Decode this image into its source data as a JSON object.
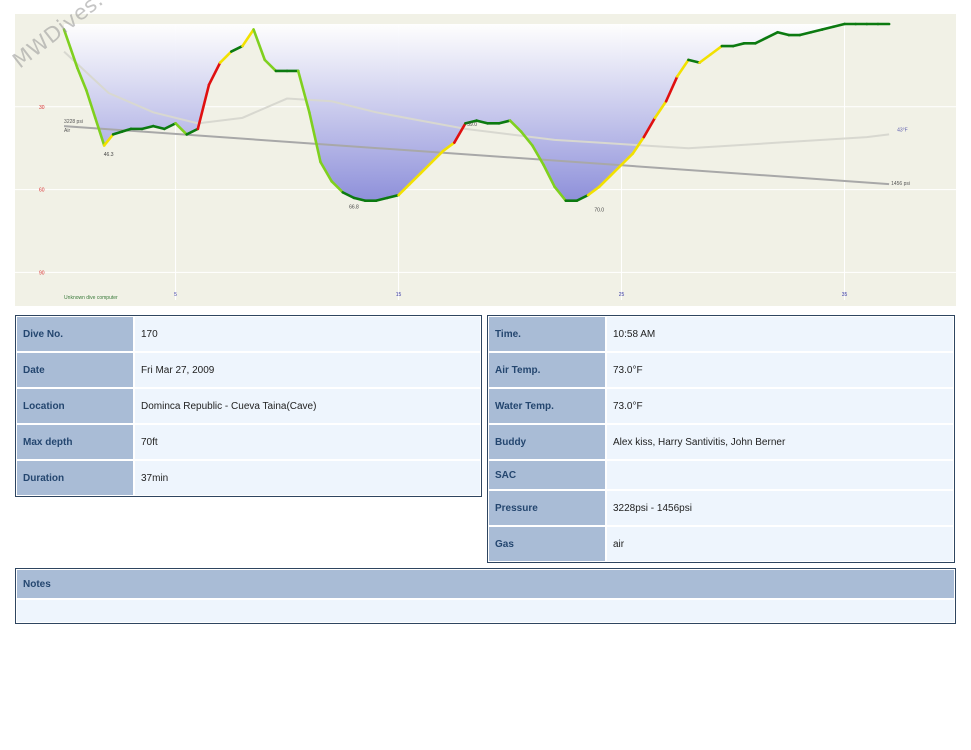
{
  "chart_data": {
    "type": "area",
    "title": "",
    "xlabel": "",
    "ylabel": "",
    "xlim": [
      -2.2,
      40
    ],
    "ylim": [
      0,
      100
    ],
    "y_inverted": true,
    "grid": true,
    "x_ticks": [
      5,
      15,
      25,
      35
    ],
    "y_ticks": [
      30,
      60,
      90
    ],
    "x_tick_labels": [
      "5",
      "15",
      "25",
      "35"
    ],
    "y_tick_labels": [
      "30",
      "60",
      "90"
    ],
    "series": [
      {
        "role": "depth",
        "x": [
          0,
          0.3,
          0.6,
          1.0,
          1.4,
          1.8,
          2.2,
          2.6,
          3.0,
          3.5,
          4.0,
          4.5,
          5.0,
          5.5,
          6.0,
          6.5,
          7.0,
          7.5,
          8.0,
          8.5,
          9.0,
          9.5,
          10.0,
          10.5,
          11.0,
          11.5,
          12.0,
          12.5,
          13.0,
          13.5,
          14.0,
          14.5,
          15.0,
          15.5,
          16.0,
          16.5,
          17.0,
          17.5,
          18.0,
          18.5,
          19.0,
          19.5,
          20.0,
          20.5,
          21.0,
          21.5,
          22.0,
          22.5,
          23.0,
          23.5,
          24.0,
          24.5,
          25.0,
          25.5,
          26.0,
          26.5,
          27.0,
          27.5,
          28.0,
          28.5,
          29.0,
          29.5,
          30.0,
          30.5,
          31.0,
          31.5,
          32.0,
          32.5,
          33.0,
          33.5,
          34.0,
          34.5,
          35.0,
          35.5,
          36.0,
          36.5,
          37.0
        ],
        "y": [
          2,
          9,
          16,
          24,
          34,
          44,
          40,
          39,
          38,
          38,
          37,
          38,
          36,
          40,
          38,
          22,
          14,
          10,
          8,
          2,
          13,
          17,
          17,
          17,
          32,
          50,
          57,
          61,
          63,
          64,
          64,
          63,
          62,
          58,
          54,
          50,
          46,
          43,
          36,
          35,
          36,
          36,
          35,
          39,
          44,
          51,
          59,
          64,
          64,
          62,
          59,
          55,
          51,
          47,
          41,
          34,
          28,
          19,
          13,
          14,
          11,
          8,
          8,
          7,
          7,
          5,
          3,
          4,
          4,
          3,
          2,
          1,
          0,
          0,
          0,
          0,
          0
        ]
      },
      {
        "role": "pressure",
        "x": [
          0,
          37
        ],
        "y": [
          37,
          58
        ]
      },
      {
        "role": "temperature",
        "x": [
          0,
          2,
          4,
          6,
          8,
          10,
          12,
          14,
          16,
          18,
          20,
          22,
          24,
          26,
          28,
          30,
          32,
          34,
          36,
          37
        ],
        "y": [
          10,
          25,
          32,
          36,
          34,
          27,
          28,
          32,
          35,
          38,
          40,
          42,
          43,
          44,
          45,
          44,
          43,
          42,
          41,
          40
        ]
      }
    ],
    "annotations": [
      {
        "text": "3228 psi",
        "x": 0,
        "y": 37
      },
      {
        "text": "Air",
        "x": 0,
        "y": 37
      },
      {
        "text": "1456 psi",
        "x": 37,
        "y": 58
      },
      {
        "text": "46.3",
        "x": 2,
        "y": 45
      },
      {
        "text": "66.8",
        "x": 13,
        "y": 64
      },
      {
        "text": "59.0",
        "x": 18.3,
        "y": 34
      },
      {
        "text": "70.0",
        "x": 24,
        "y": 65
      },
      {
        "text": "43°F",
        "x": 37,
        "y": 40
      },
      {
        "text": "Unknown dive computer",
        "x": 0,
        "y": 100
      }
    ],
    "colors": {
      "area": "#8e90da",
      "background": "#f1f1e6",
      "pressure": "#a8a8a8",
      "temperature": "#d8d8d0",
      "slow": "#0c7a10",
      "medium": "#7fd01f",
      "fast": "#f2e100",
      "very_fast": "#e01010",
      "axis_text": "#d83030",
      "time_text": "#3a3aa8"
    }
  },
  "watermark": "MWDives.com",
  "dive_left": [
    {
      "label": "Dive No.",
      "value": "170"
    },
    {
      "label": "Date",
      "value": "Fri Mar 27, 2009"
    },
    {
      "label": "Location",
      "value": "Dominca Republic - Cueva Taina(Cave)"
    },
    {
      "label": "Max depth",
      "value": "70ft"
    },
    {
      "label": "Duration",
      "value": "37min"
    }
  ],
  "dive_right": [
    {
      "label": "Time.",
      "value": "10:58 AM"
    },
    {
      "label": "Air Temp.",
      "value": "73.0°F"
    },
    {
      "label": "Water Temp.",
      "value": "73.0°F"
    },
    {
      "label": "Buddy",
      "value": "Alex kiss, Harry Santivitis, John Berner"
    },
    {
      "label": "SAC",
      "value": ""
    },
    {
      "label": "Pressure",
      "value": "3228psi - 1456psi"
    },
    {
      "label": "Gas",
      "value": "air"
    }
  ],
  "notes": {
    "label": "Notes",
    "value": ""
  }
}
